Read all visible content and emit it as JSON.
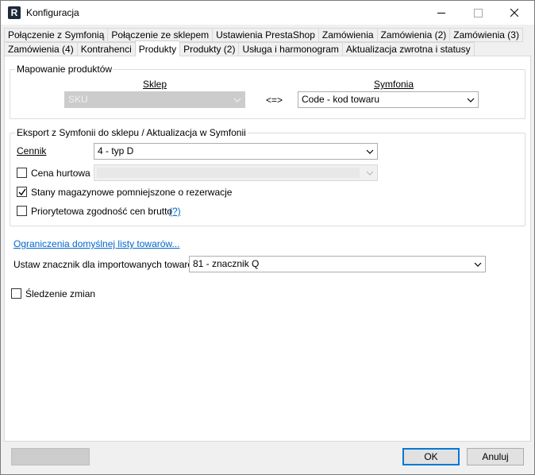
{
  "window": {
    "title": "Konfiguracja",
    "icon_letter": "R"
  },
  "tabs": {
    "row1": [
      "Połączenie z Symfonią",
      "Połączenie ze sklepem",
      "Ustawienia PrestaShop",
      "Zamówienia",
      "Zamówienia (2)",
      "Zamówienia (3)"
    ],
    "row2": [
      "Zamówienia (4)",
      "Kontrahenci",
      "Produkty",
      "Produkty (2)",
      "Usługa i harmonogram",
      "Aktualizacja zwrotna i statusy"
    ],
    "active": "Produkty"
  },
  "mapping": {
    "legend": "Mapowanie produktów",
    "shop_header": "Sklep",
    "symfonia_header": "Symfonia",
    "shop_value": "SKU",
    "arrow": "<=>",
    "symfonia_value": "Code - kod towaru"
  },
  "export": {
    "legend": "Eksport z Symfonii do sklepu / Aktualizacja w Symfonii",
    "price_list_label": "Cennik",
    "price_list_value": "4 - typ D",
    "wholesale_label": "Cena hurtowa",
    "wholesale_checked": false,
    "stock_label": "Stany magazynowe pomniejszone o rezerwacje",
    "stock_checked": true,
    "gross_label": "Priorytetowa zgodność cen brutto",
    "gross_checked": false,
    "help_link": "(?)"
  },
  "limits_link": "Ograniczenia domyślnej listy towarów...",
  "marker": {
    "label": "Ustaw znacznik dla importowanych towarów:",
    "value": "81 - znacznik Q"
  },
  "tracking": {
    "label": "Śledzenie zmian",
    "checked": false
  },
  "buttons": {
    "ok": "OK",
    "cancel": "Anuluj"
  },
  "colors": {
    "link": "#0066cc",
    "default_button_border": "#0078d7"
  }
}
